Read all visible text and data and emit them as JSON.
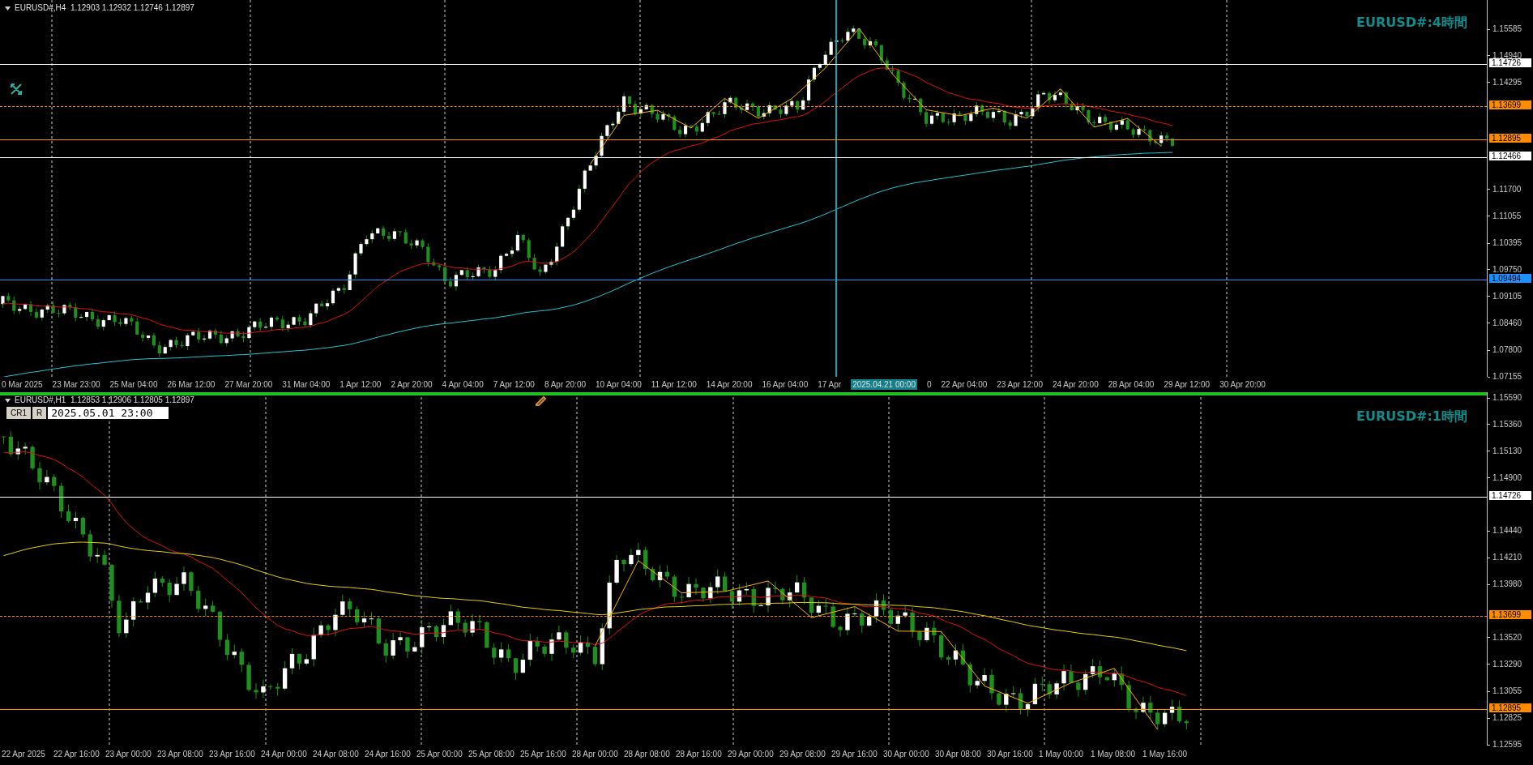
{
  "charts": [
    {
      "symbol_info": "EURUSD#,H4  1.12903 1.12932 1.12746 1.12897",
      "title": "EURUSD#:4時間",
      "active": false,
      "price_labels": [
        "1.15585",
        "1.14940",
        "1.14295",
        "1.11700",
        "1.11055",
        "1.10395",
        "1.09750",
        "1.09105",
        "1.08460",
        "1.07800",
        "1.07155"
      ],
      "price_lines": [
        {
          "label": "1.14726",
          "color": "#ffffff",
          "dashed": false
        },
        {
          "label": "1.13699",
          "color": "#ff8c00",
          "dashed": true
        },
        {
          "label": "1.12895",
          "color": "#ff8c00",
          "dashed": false
        },
        {
          "label": "1.12466",
          "color": "#ffffff",
          "dashed": false
        },
        {
          "label": "1.09494",
          "color": "#1e90ff",
          "dashed": false
        }
      ],
      "time_labels": [
        {
          "text": "0 Mar 2025",
          "kind": "tick"
        },
        {
          "text": "23 Mar 23:00",
          "kind": "tick"
        },
        {
          "text": "25 Mar 04:00",
          "kind": "tick"
        },
        {
          "text": "26 Mar 12:00",
          "kind": "tick"
        },
        {
          "text": "27 Mar 20:00",
          "kind": "tick"
        },
        {
          "text": "31 Mar 04:00",
          "kind": "tick"
        },
        {
          "text": "1 Apr 12:00",
          "kind": "tick"
        },
        {
          "text": "2 Apr 20:00",
          "kind": "tick"
        },
        {
          "text": "4 Apr 04:00",
          "kind": "tick"
        },
        {
          "text": "7 Apr 12:00",
          "kind": "tick"
        },
        {
          "text": "8 Apr 20:00",
          "kind": "tick"
        },
        {
          "text": "10 Apr 04:00",
          "kind": "tick"
        },
        {
          "text": "11 Apr 12:00",
          "kind": "tick"
        },
        {
          "text": "14 Apr 20:00",
          "kind": "tick"
        },
        {
          "text": "16 Apr 04:00",
          "kind": "tick"
        },
        {
          "text": "17 Apr",
          "kind": "tick"
        },
        {
          "text": "2025.04.21 00:00",
          "kind": "cursor"
        },
        {
          "text": "0",
          "kind": "tick"
        },
        {
          "text": "22 Apr 04:00",
          "kind": "tick"
        },
        {
          "text": "23 Apr 12:00",
          "kind": "tick"
        },
        {
          "text": "24 Apr 20:00",
          "kind": "tick"
        },
        {
          "text": "28 Apr 04:00",
          "kind": "tick"
        },
        {
          "text": "29 Apr 12:00",
          "kind": "tick"
        },
        {
          "text": "30 Apr 20:00",
          "kind": "tick"
        }
      ]
    },
    {
      "symbol_info": "EURUSD#,H1  1.12853 1.12906 1.12805 1.12897",
      "title": "EURUSD#:1時間",
      "active": true,
      "toolbar": {
        "buttons": [
          "CR1",
          "R"
        ],
        "datetime": "2025.05.01 23:00"
      },
      "price_labels": [
        "1.15590",
        "1.15360",
        "1.15130",
        "1.14900",
        "1.14440",
        "1.14210",
        "1.13980",
        "1.13520",
        "1.13290",
        "1.13055",
        "1.12825",
        "1.12595"
      ],
      "price_lines": [
        {
          "label": "1.14726",
          "color": "#ffffff",
          "dashed": false
        },
        {
          "label": "1.13699",
          "color": "#ff8c00",
          "dashed": true
        },
        {
          "label": "1.12895",
          "color": "#ff8c00",
          "dashed": false
        }
      ],
      "time_labels": [
        {
          "text": "22 Apr 2025",
          "kind": "tick"
        },
        {
          "text": "22 Apr 16:00",
          "kind": "tick"
        },
        {
          "text": "23 Apr 00:00",
          "kind": "tick"
        },
        {
          "text": "23 Apr 08:00",
          "kind": "tick"
        },
        {
          "text": "23 Apr 16:00",
          "kind": "tick"
        },
        {
          "text": "24 Apr 00:00",
          "kind": "tick"
        },
        {
          "text": "24 Apr 08:00",
          "kind": "tick"
        },
        {
          "text": "24 Apr 16:00",
          "kind": "tick"
        },
        {
          "text": "25 Apr 00:00",
          "kind": "tick"
        },
        {
          "text": "25 Apr 08:00",
          "kind": "tick"
        },
        {
          "text": "25 Apr 16:00",
          "kind": "tick"
        },
        {
          "text": "28 Apr 00:00",
          "kind": "tick"
        },
        {
          "text": "28 Apr 08:00",
          "kind": "tick"
        },
        {
          "text": "28 Apr 16:00",
          "kind": "tick"
        },
        {
          "text": "29 Apr 00:00",
          "kind": "tick"
        },
        {
          "text": "29 Apr 08:00",
          "kind": "tick"
        },
        {
          "text": "29 Apr 16:00",
          "kind": "tick"
        },
        {
          "text": "30 Apr 00:00",
          "kind": "tick"
        },
        {
          "text": "30 Apr 08:00",
          "kind": "tick"
        },
        {
          "text": "30 Apr 16:00",
          "kind": "tick"
        },
        {
          "text": "1 May 00:00",
          "kind": "tick"
        },
        {
          "text": "1 May 08:00",
          "kind": "tick"
        },
        {
          "text": "1 May 16:00",
          "kind": "tick"
        }
      ]
    }
  ]
}
